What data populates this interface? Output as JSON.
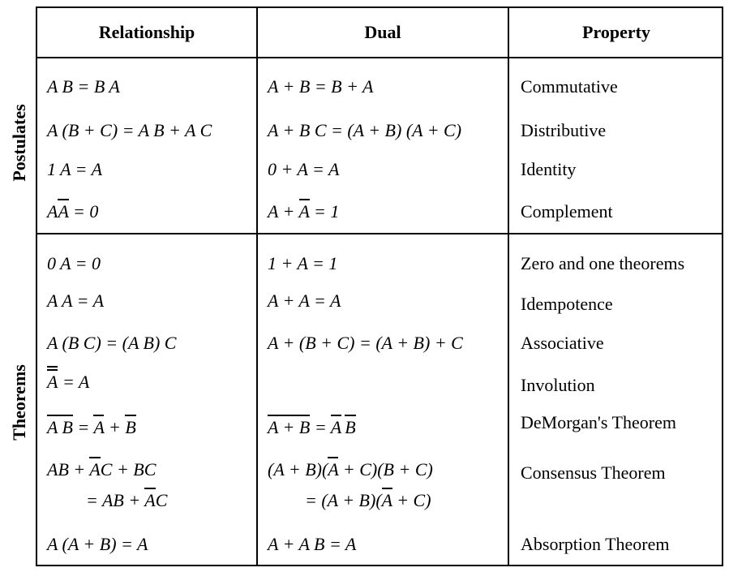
{
  "headers": {
    "relationship": "Relationship",
    "dual": "Dual",
    "property": "Property"
  },
  "sections": {
    "postulates": "Postulates",
    "theorems": "Theorems"
  },
  "rows": {
    "r1": {
      "rel": "A B = B A",
      "dual": "A + B = B + A",
      "prop": "Commutative"
    },
    "r2": {
      "rel": "A (B + C) = A B + A C",
      "dual": "A + B C = (A + B) (A + C)",
      "prop": "Distributive"
    },
    "r3": {
      "rel": "1 A = A",
      "dual": "0 + A = A",
      "prop": "Identity"
    },
    "r4": {
      "rel_a": "A",
      "rel_abar": "A",
      "rel_rest": " = 0",
      "dual_a": "A + ",
      "dual_abar": "A",
      "dual_rest": " = 1",
      "prop": "Complement"
    },
    "r5": {
      "rel": "0 A = 0",
      "dual": "1 + A = 1",
      "prop": "Zero and one theorems"
    },
    "r6": {
      "rel": "A A = A",
      "dual": "A + A = A",
      "prop": "Idempotence"
    },
    "r7": {
      "rel": "A (B C) = (A B) C",
      "dual": "A + (B + C) = (A + B) + C",
      "prop": "Associative"
    },
    "r8": {
      "rel_abar": "A",
      "rel_rest": " = A",
      "prop": "Involution"
    },
    "r9": {
      "rel_over": "A B",
      "rel_mid": " = ",
      "rel_abar": "A",
      "rel_plus": " + ",
      "rel_bbar": "B",
      "dual_over": "A + B",
      "dual_mid": " = ",
      "dual_abar": "A",
      "dual_bbar": "B",
      "prop": "DeMorgan's Theorem"
    },
    "r10": {
      "rel_l1_a": "AB + ",
      "rel_l1_abar": "A",
      "rel_l1_b": "C + BC",
      "rel_l2_a": "= AB + ",
      "rel_l2_abar": "A",
      "rel_l2_b": "C",
      "dual_l1_a": "(A + B)(",
      "dual_l1_abar": "A",
      "dual_l1_b": " + C)(B + C)",
      "dual_l2_a": "= (A + B)(",
      "dual_l2_abar": "A",
      "dual_l2_b": " + C)",
      "prop": "Consensus Theorem"
    },
    "r11": {
      "rel": "A (A + B) = A",
      "dual": "A + A B = A",
      "prop": "Absorption Theorem"
    }
  }
}
